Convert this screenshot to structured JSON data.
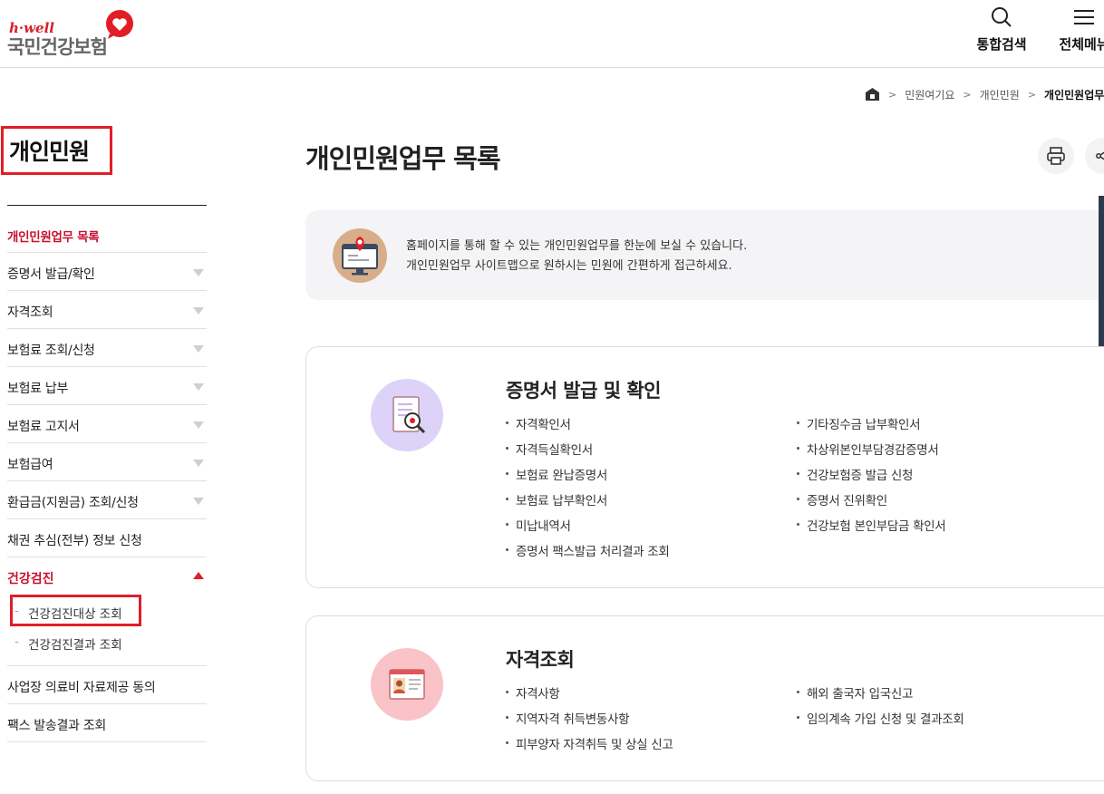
{
  "header": {
    "logo_small": "h·well",
    "logo_main": "국민건강보험",
    "search_label": "통합검색",
    "menu_label": "전체메뉴"
  },
  "breadcrumb": [
    "민원여기요",
    "개인민원",
    "개인민원업무 목"
  ],
  "sidebar": {
    "title": "개인민원",
    "items": [
      {
        "label": "개인민원업무 목록"
      },
      {
        "label": "증명서 발급/확인"
      },
      {
        "label": "자격조회"
      },
      {
        "label": "보험료 조회/신청"
      },
      {
        "label": "보험료 납부"
      },
      {
        "label": "보험료 고지서"
      },
      {
        "label": "보험급여"
      },
      {
        "label": "환급금(지원금) 조회/신청"
      },
      {
        "label": "채권 추심(전부) 정보 신청"
      }
    ],
    "expanded": {
      "label": "건강검진",
      "sub": [
        "건강검진대상 조회",
        "건강검진결과 조회"
      ]
    },
    "after": [
      {
        "label": "사업장 의료비 자료제공 동의"
      },
      {
        "label": "팩스 발송결과 조회"
      }
    ]
  },
  "main": {
    "title": "개인민원업무 목록",
    "intro_line1": "홈페이지를 통해 할 수 있는 개인민원업무를 한눈에 보실 수 있습니다.",
    "intro_line2": "개인민원업무 사이트맵으로 원하시는 민원에 간편하게 접근하세요.",
    "sections": [
      {
        "title": "증명서 발급 및 확인",
        "left": [
          "자격확인서",
          "자격득실확인서",
          "보험료 완납증명서",
          "보험료 납부확인서",
          "미납내역서",
          "증명서 팩스발급 처리결과 조회"
        ],
        "right": [
          "기타징수금 납부확인서",
          "차상위본인부담경감증명서",
          "건강보험증 발급 신청",
          "증명서 진위확인",
          "건강보험 본인부담금 확인서"
        ]
      },
      {
        "title": "자격조회",
        "left": [
          "자격사항",
          "지역자격 취득변동사항",
          "피부양자 자격취득 및 상실 신고"
        ],
        "right": [
          "해외 출국자 입국신고",
          "임의계속 가입 신청 및 결과조회"
        ]
      }
    ]
  },
  "colors": {
    "accent": "#c8102e",
    "highlight_box": "#e01e27"
  }
}
